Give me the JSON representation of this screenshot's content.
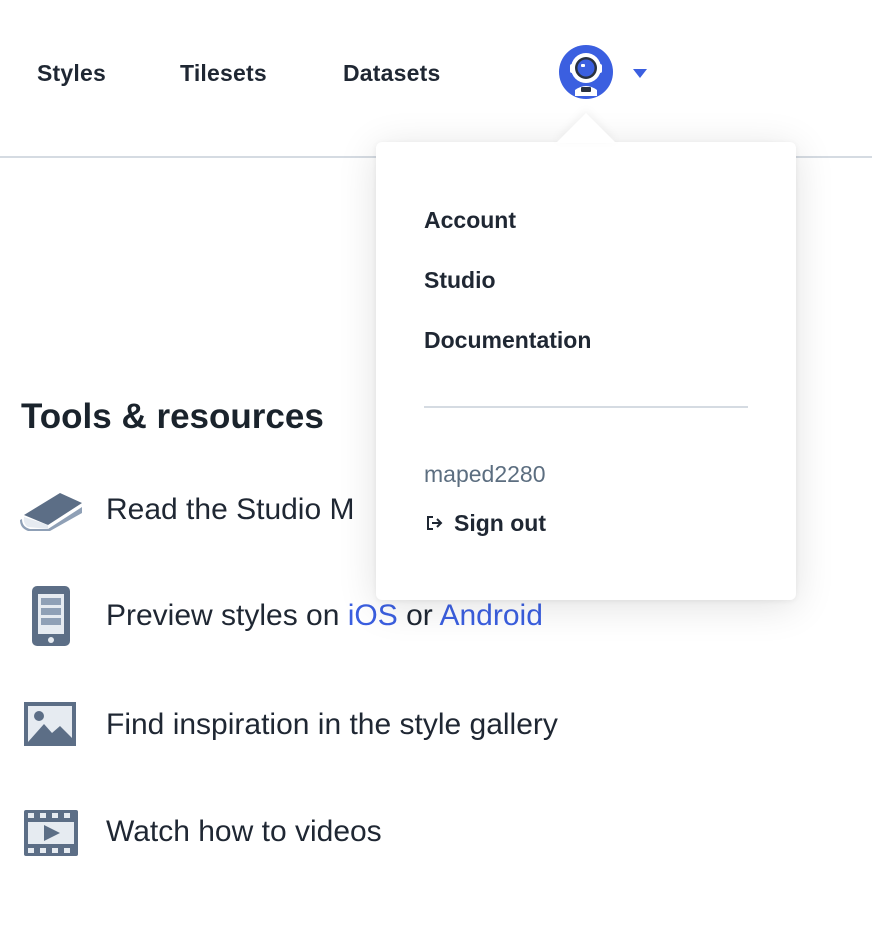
{
  "nav": {
    "items": [
      {
        "label": "Styles"
      },
      {
        "label": "Tilesets"
      },
      {
        "label": "Datasets"
      }
    ],
    "avatar_icon": "astronaut-avatar-icon",
    "caret_icon": "caret-down-icon",
    "accent_color": "#3b5fe0"
  },
  "tools": {
    "heading": "Tools & resources",
    "manual": {
      "icon": "book-icon",
      "text": "Read the Studio M"
    },
    "preview": {
      "icon": "phone-icon",
      "prefix": "Preview styles on ",
      "ios": "iOS",
      "or": " or ",
      "android": "Android"
    },
    "gallery": {
      "icon": "image-icon",
      "text": "Find inspiration in the style gallery"
    },
    "videos": {
      "icon": "film-icon",
      "text": "Watch how to videos"
    }
  },
  "dropdown": {
    "items": [
      {
        "label": "Account"
      },
      {
        "label": "Studio"
      },
      {
        "label": "Documentation"
      }
    ],
    "username": "maped2280",
    "signout_label": "Sign out",
    "signout_icon": "sign-out-icon"
  }
}
